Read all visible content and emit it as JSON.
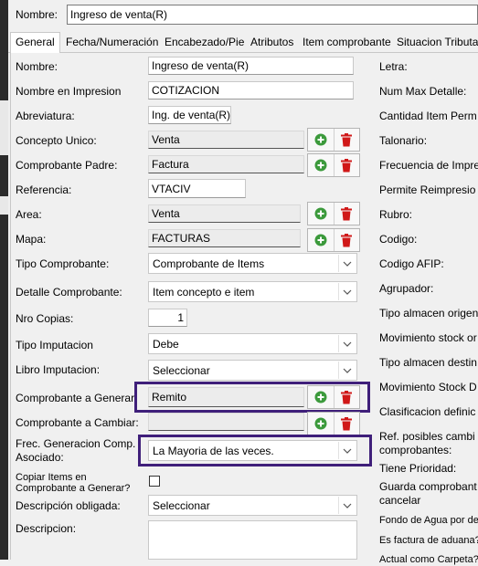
{
  "header": {
    "name_label": "Nombre:",
    "name_value": "Ingreso de venta(R)"
  },
  "tabs": [
    {
      "label": "General"
    },
    {
      "label": "Fecha/Numeración"
    },
    {
      "label": "Encabezado/Pie"
    },
    {
      "label": "Atributos"
    },
    {
      "label": "Item comprobante"
    },
    {
      "label": "Situacion Tributaria"
    }
  ],
  "left": {
    "nombre": {
      "label": "Nombre:",
      "value": "Ingreso de venta(R)"
    },
    "nombre_impresion": {
      "label": "Nombre en Impresion",
      "value": "COTIZACION"
    },
    "abreviatura": {
      "label": "Abreviatura:",
      "value": "Ing. de venta(R)"
    },
    "concepto_unico": {
      "label": "Concepto Unico:",
      "value": "Venta"
    },
    "comprobante_padre": {
      "label": "Comprobante Padre:",
      "value": "Factura"
    },
    "referencia": {
      "label": "Referencia:",
      "value": "VTACIV"
    },
    "area": {
      "label": "Area:",
      "value": "Venta"
    },
    "mapa": {
      "label": "Mapa:",
      "value": "FACTURAS"
    },
    "tipo_comprobante": {
      "label": "Tipo Comprobante:",
      "value": "Comprobante de Items"
    },
    "detalle_comprobante": {
      "label": "Detalle Comprobante:",
      "value": "Item concepto e item"
    },
    "nro_copias": {
      "label": "Nro Copias:",
      "value": "1"
    },
    "tipo_imputacion": {
      "label": "Tipo Imputacion",
      "value": "Debe"
    },
    "libro_imputacion": {
      "label": "Libro Imputacion:",
      "value": "Seleccionar"
    },
    "comprobante_generar": {
      "label": "Comprobante a Generar:",
      "value": "Remito"
    },
    "comprobante_cambiar": {
      "label": "Comprobante a Cambiar:",
      "value": ""
    },
    "frec_generacion": {
      "label_line1": "Frec. Generacion Comp.",
      "label_line2": "Asociado:",
      "value": "La Mayoria de las veces."
    },
    "copiar_items": {
      "label_line1": "Copiar Items en",
      "label_line2": "Comprobante a Generar?"
    },
    "descripcion_obligada": {
      "label": "Descripción obligada:",
      "value": "Seleccionar"
    },
    "descripcion": {
      "label": "Descripcion:"
    }
  },
  "right": {
    "letra": "Letra:",
    "num_max_detalle": "Num Max Detalle:",
    "cantidad_item": "Cantidad Item Perm",
    "talonario": "Talonario:",
    "frecuencia_impresion": "Frecuencia de Impre",
    "permite_reimpresion": "Permite Reimpresio",
    "rubro": "Rubro:",
    "codigo": "Codigo:",
    "codigo_afip": "Codigo AFIP:",
    "agrupador": "Agrupador:",
    "tipo_almacen_origen": "Tipo almacen origen",
    "movimiento_stock_or": "Movimiento stock or",
    "tipo_almacen_destino": "Tipo almacen destin",
    "movimiento_stock_d": "Movimiento Stock D",
    "clasificacion": "Clasificacion definic",
    "ref_posibles_line1": "Ref. posibles cambi",
    "ref_posibles_line2": "comprobantes:",
    "tiene_prioridad": "Tiene Prioridad:",
    "guarda_line1": "Guarda comprobant",
    "guarda_line2": "cancelar",
    "fondo_agua": "Fondo de Agua por def",
    "factura_aduana": "Es factura de aduana?",
    "actual_carpeta": "Actual como Carpeta?"
  }
}
